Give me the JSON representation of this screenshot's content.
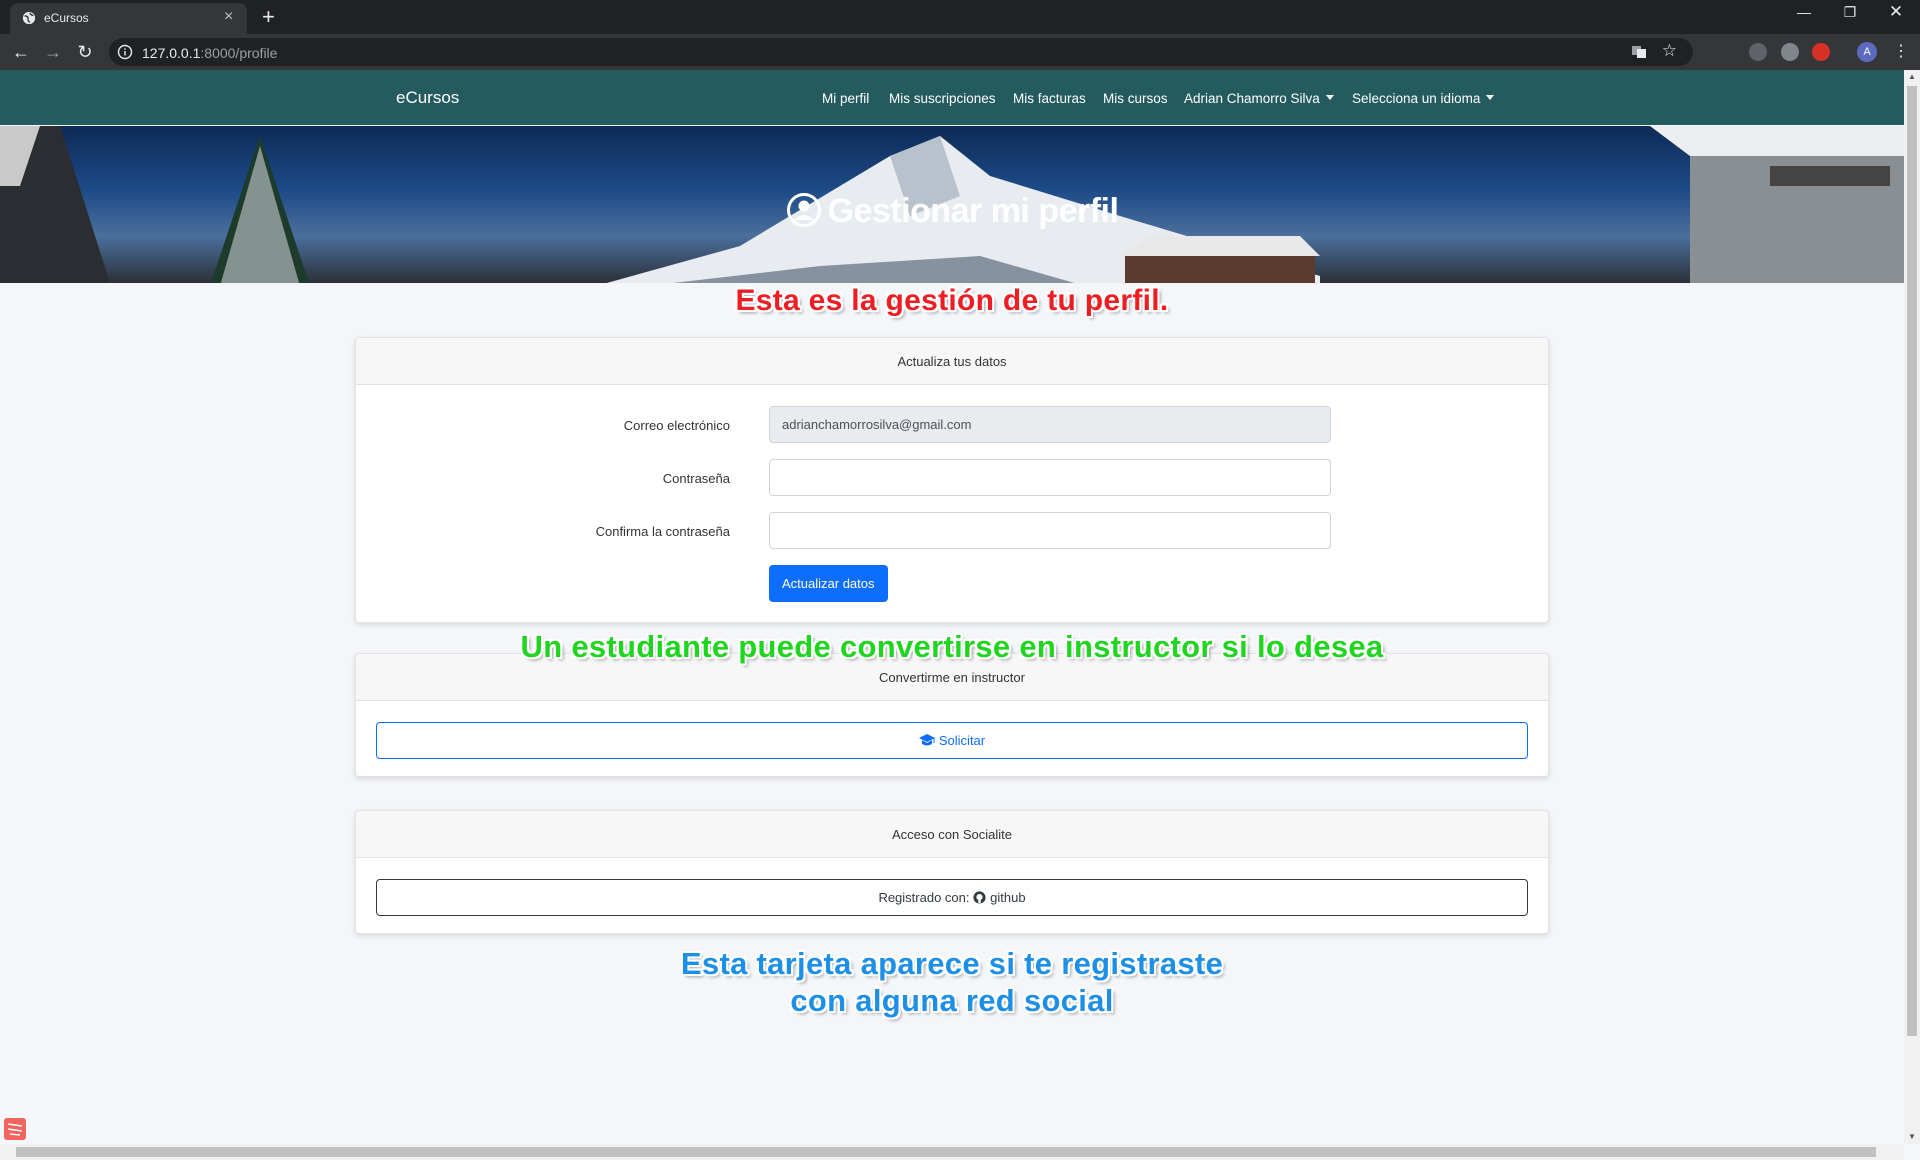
{
  "browser": {
    "tab_title": "eCursos",
    "url_host": "127.0.0.1",
    "url_rest": ":8000/profile",
    "avatar_letter": "A"
  },
  "navbar": {
    "brand": "eCursos",
    "links": [
      "Mi perfil",
      "Mis suscripciones",
      "Mis facturas",
      "Mis cursos"
    ],
    "user_menu": "Adrian Chamorro Silva",
    "language_menu": "Selecciona un idioma",
    "background_color": "#245b5f"
  },
  "hero": {
    "title": "Gestionar mi perfil"
  },
  "annotations": {
    "profile_note": "Esta es la gestión de tu perfil.",
    "instructor_note": "Un estudiante puede convertirse en instructor si lo desea",
    "social_note_line1": "Esta tarjeta aparece si te registraste",
    "social_note_line2": "con alguna red social"
  },
  "update_card": {
    "header": "Actualiza tus datos",
    "email_label": "Correo electrónico",
    "email_value": "adrianchamorrosilva@gmail.com",
    "password_label": "Contraseña",
    "password_value": "",
    "confirm_label": "Confirma la contraseña",
    "confirm_value": "",
    "submit_label": "Actualizar datos"
  },
  "instructor_card": {
    "header": "Convertirme en instructor",
    "button_label": "Solicitar",
    "button_icon": "graduation-cap-icon"
  },
  "social_card": {
    "header": "Acceso con Socialite",
    "registered_prefix": "Registrado con:",
    "provider": "github",
    "provider_icon": "github-icon"
  },
  "colors": {
    "primary": "#0d6efd",
    "annotation_red": "#ee1d23",
    "annotation_green": "#1fd51f",
    "annotation_blue": "#1d8fe6"
  }
}
